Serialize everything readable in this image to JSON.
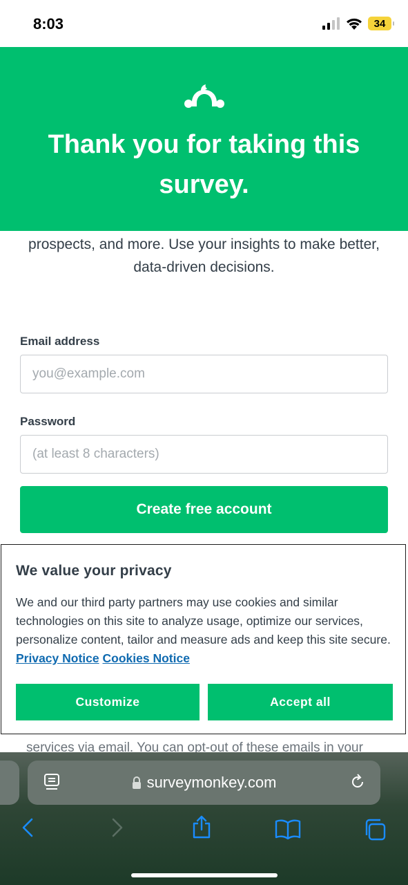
{
  "status_bar": {
    "time": "8:03",
    "battery": "34"
  },
  "hero": {
    "title": "Thank you for taking this survey."
  },
  "intro": {
    "text": "prospects, and more. Use your insights to make better, data-driven decisions."
  },
  "form": {
    "email_label": "Email address",
    "email_placeholder": "you@example.com",
    "email_value": "",
    "password_label": "Password",
    "password_placeholder": "(at least 8 characters)",
    "password_value": "",
    "submit_label": "Create free account"
  },
  "behind_text": "services via email. You can opt-out of these emails in your",
  "cookie_banner": {
    "title": "We value your privacy",
    "body": "We and our third party partners may use cookies and similar technologies on this site to analyze usage, optimize our services, personalize content, tailor and measure ads and keep this site secure.",
    "privacy_link": "Privacy Notice",
    "cookies_link": "Cookies Notice",
    "customize_label": "Customize",
    "accept_label": "Accept all"
  },
  "browser": {
    "url": "surveymonkey.com",
    "icons": [
      "reader-icon",
      "lock-icon",
      "reload-icon",
      "back-icon",
      "forward-icon",
      "share-icon",
      "bookmarks-icon",
      "tabs-icon"
    ]
  },
  "colors": {
    "brand_green": "#00bf6f",
    "link_blue": "#0f6ab0",
    "text": "#333e48"
  }
}
